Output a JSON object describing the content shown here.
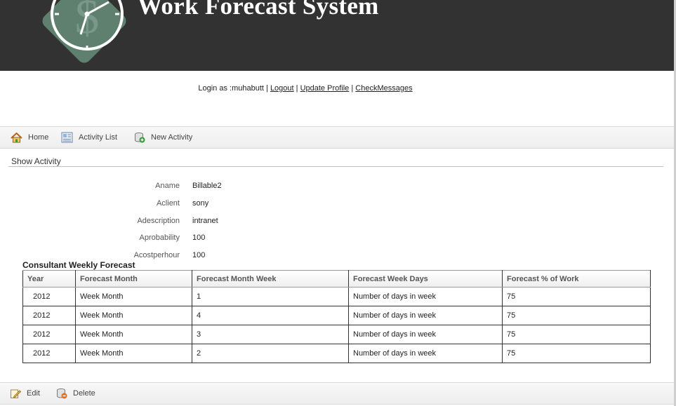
{
  "header": {
    "title": "Work Forecast System",
    "logo_icon": "clock-dollar-logo-icon"
  },
  "login": {
    "prefix": "Login as :muhabutt",
    "sep": "|",
    "logout": "Logout",
    "update_profile": "Update Profile",
    "check_messages": "CheckMessages"
  },
  "nav": {
    "home": "Home",
    "activity_list": "Activity List",
    "new_activity": "New Activity"
  },
  "page_title": "Show Activity",
  "properties": [
    {
      "label": "Aname",
      "value": "Billable2"
    },
    {
      "label": "Aclient",
      "value": "sony"
    },
    {
      "label": "Adescription",
      "value": "intranet"
    },
    {
      "label": "Aprobability",
      "value": "100"
    },
    {
      "label": "Acostperhour",
      "value": "100"
    }
  ],
  "forecast": {
    "title": "Consultant Weekly Forecast",
    "headers": [
      "Year",
      "Forecast Month",
      "Forecast Month Week",
      "Forecast Week Days",
      "Forecast % of Work"
    ],
    "rows": [
      [
        "2012",
        "Week Month",
        "1",
        "Number of days in week",
        "75"
      ],
      [
        "2012",
        "Week Month",
        "4",
        "Number of days in week",
        "75"
      ],
      [
        "2012",
        "Week Month",
        "3",
        "Number of days in week",
        "75"
      ],
      [
        "2012",
        "Week Month",
        "2",
        "Number of days in week",
        "75"
      ]
    ]
  },
  "actions": {
    "edit": "Edit",
    "delete": "Delete"
  },
  "colors": {
    "header_bg": "#323232",
    "logo_green": "#5f7f6f",
    "toolbar_bg": "#f1f1f1"
  }
}
